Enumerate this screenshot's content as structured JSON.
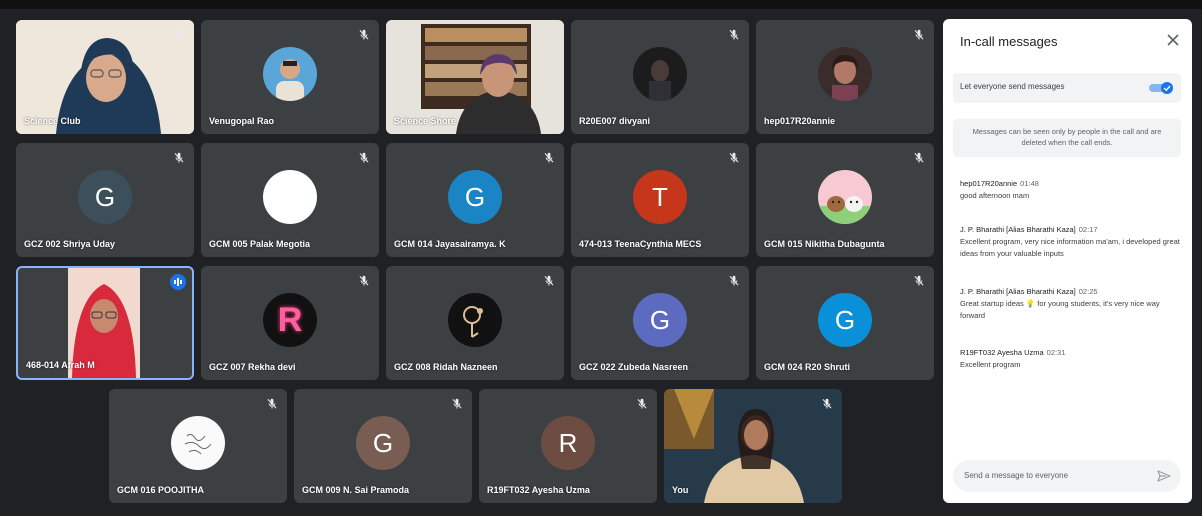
{
  "tiles": [
    {
      "name": "Science Club"
    },
    {
      "name": "Venugopal Rao"
    },
    {
      "name": "Science Shore"
    },
    {
      "name": "R20E007 divyani"
    },
    {
      "name": "hep017R20annie"
    },
    {
      "name": "GCZ 002 Shriya Uday",
      "initial": "G",
      "color": "#3c4f5a"
    },
    {
      "name": "GCM 005 Palak Megotia"
    },
    {
      "name": "GCM 014 Jayasairamya. K",
      "initial": "G",
      "color": "#1a84c4"
    },
    {
      "name": "474-013 TeenaCynthia MECS",
      "initial": "T",
      "color": "#c5361b"
    },
    {
      "name": "GCM 015 Nikitha Dubagunta"
    },
    {
      "name": "468-014 Afrah M"
    },
    {
      "name": "GCZ 007 Rekha devi",
      "initial": "R"
    },
    {
      "name": "GCZ 008 Ridah Nazneen"
    },
    {
      "name": "GCZ 022 Zubeda Nasreen",
      "initial": "G",
      "color": "#5c6bc0"
    },
    {
      "name": "GCM 024 R20 Shruti",
      "initial": "G",
      "color": "#0a8fd9"
    },
    {
      "name": "GCM 016 POOJITHA"
    },
    {
      "name": "GCM 009 N. Sai Pramoda",
      "initial": "G",
      "color": "#7a5d52"
    },
    {
      "name": "R19FT032 Ayesha Uzma",
      "initial": "R",
      "color": "#6d4c41"
    },
    {
      "name": "You"
    }
  ],
  "chat": {
    "title": "In-call messages",
    "toggle_label": "Let everyone send messages",
    "toggle_on": true,
    "notice": "Messages can be seen only by people in the call and are deleted when the call ends.",
    "messages": [
      {
        "sender": "hep017R20annie",
        "time": "01:48",
        "text": "good afternoon mam"
      },
      {
        "sender": "J. P. Bharathi [Alias Bharathi Kaza]",
        "time": "02:17",
        "text": "Excellent program, very nice information ma'am, i developed great ideas from your valuable inputs"
      },
      {
        "sender": "J. P. Bharathi [Alias Bharathi Kaza]",
        "time": "02:25",
        "text": "Great startup ideas 💡 for young students, it's very nice way forward"
      },
      {
        "sender": "R19FT032 Ayesha Uzma",
        "time": "02:31",
        "text": "Excellent  program"
      }
    ],
    "input_placeholder": "Send a message to everyone"
  },
  "colors": {
    "accent": "#1a73e8",
    "tile_bg": "#3c4043",
    "page_bg": "#202124"
  }
}
